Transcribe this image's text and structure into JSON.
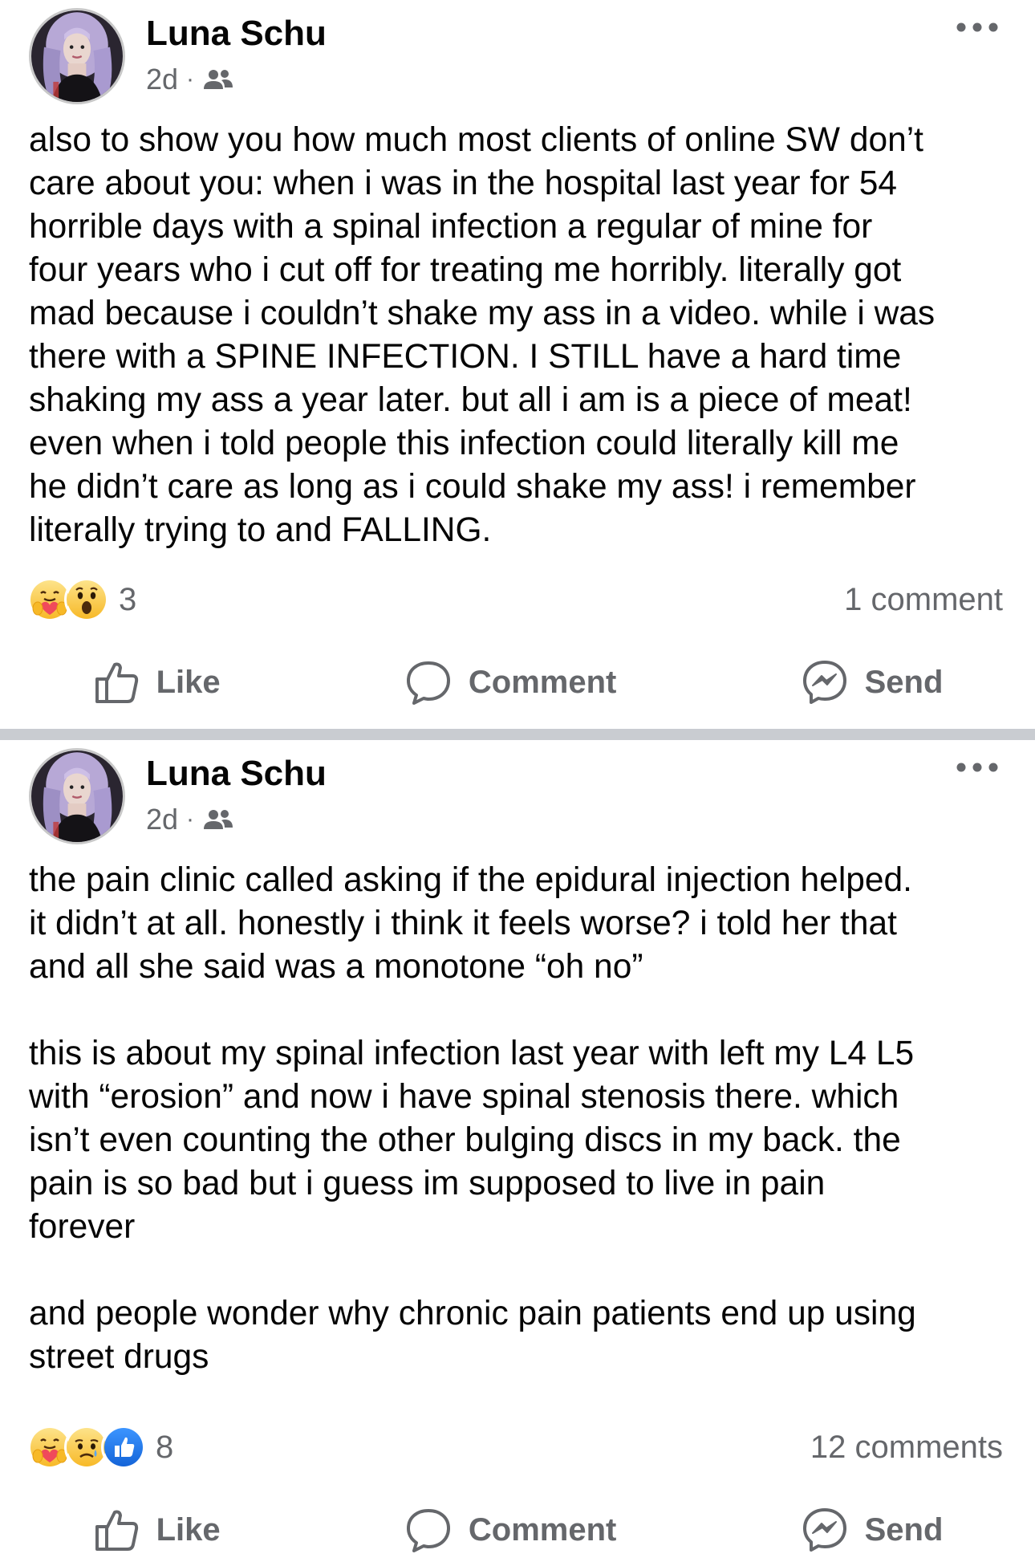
{
  "posts": [
    {
      "author": "Luna Schu",
      "time": "2d",
      "dot": "·",
      "audience_icon": "friends-icon",
      "text": "also to show you how much most clients of online SW don’t\ncare about you: when i was in the hospital last year for 54\nhorrible days with a spinal infection a regular of mine for\nfour years who i cut off for treating me horribly. literally got\nmad because i couldn’t shake my ass in a video. while i was\nthere with a SPINE INFECTION. I STILL have a hard time\nshaking my ass a year later. but all i am is a piece of meat!\neven when i told people this infection could literally kill me\nhe didn’t care as long as i could shake my ass! i remember\nliterally trying to and FALLING.",
      "reactions": [
        "care",
        "wow"
      ],
      "reaction_count": "3",
      "comments": "1 comment",
      "actions": {
        "like": "Like",
        "comment": "Comment",
        "send": "Send"
      }
    },
    {
      "author": "Luna Schu",
      "time": "2d",
      "dot": "·",
      "audience_icon": "friends-icon",
      "text": "the pain clinic called asking if the epidural injection helped.\nit didn’t at all. honestly i think it feels worse? i told her that\nand all she said was a monotone “oh no”\n\nthis is about my spinal infection last year with left my L4 L5\nwith “erosion” and now i have spinal stenosis there. which\nisn’t even counting the other bulging discs in my back. the\npain is so bad but i guess im supposed to live in pain\nforever\n\nand people wonder why chronic pain patients end up using\nstreet drugs",
      "reactions": [
        "care",
        "sad",
        "like"
      ],
      "reaction_count": "8",
      "comments": "12 comments",
      "actions": {
        "like": "Like",
        "comment": "Comment",
        "send": "Send"
      }
    }
  ],
  "colors": {
    "text": "#050505",
    "secondary": "#65676b",
    "separator": "#c9ccd1",
    "like_blue": "#1877f2",
    "reaction_yellow": "#f7b928"
  }
}
